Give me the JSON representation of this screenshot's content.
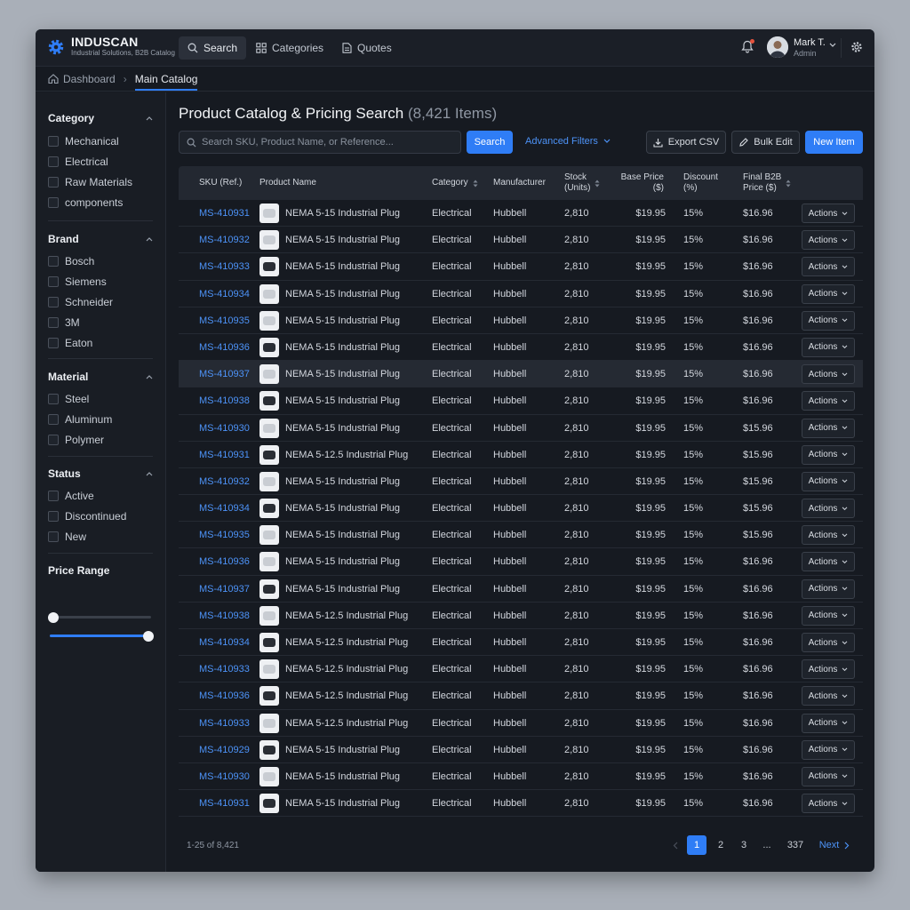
{
  "app": {
    "name": "INDUSCAN",
    "tagline": "Industrial Solutions, B2B Catalog"
  },
  "nav": {
    "search": "Search",
    "categories": "Categories",
    "quotes": "Quotes"
  },
  "user": {
    "name": "Mark T.",
    "role": "Admin"
  },
  "breadcrumb": {
    "home": "Dashboard",
    "current": "Main Catalog"
  },
  "filters": {
    "category": {
      "title": "Category",
      "items": [
        "Mechanical",
        "Electrical",
        "Raw Materials",
        "components"
      ]
    },
    "brand": {
      "title": "Brand",
      "items": [
        "Bosch",
        "Siemens",
        "Schneider",
        "3M",
        "Eaton"
      ]
    },
    "material": {
      "title": "Material",
      "items": [
        "Steel",
        "Aluminum",
        "Polymer"
      ]
    },
    "status": {
      "title": "Status",
      "items": [
        "Active",
        "Discontinued",
        "New"
      ]
    },
    "price": {
      "title": "Price Range",
      "min_fraction": 0.0,
      "max_fraction": 1.0
    }
  },
  "main": {
    "title": "Product Catalog & Pricing Search",
    "count": "(8,421 Items)",
    "search_placeholder": "Search SKU, Product Name, or Reference...",
    "search_button": "Search",
    "advanced_filters": "Advanced Filters",
    "export_csv": "Export CSV",
    "bulk_edit": "Bulk Edit",
    "new_item": "New Item"
  },
  "table": {
    "headers": {
      "sku": "SKU (Ref.)",
      "product": "Product Name",
      "category": "Category",
      "manufacturer": "Manufacturer",
      "stock_1": "Stock",
      "stock_2": "(Units)",
      "base_1": "Base Price",
      "base_2": "($)",
      "disc_1": "Discount",
      "disc_2": "(%)",
      "final_1": "Final B2B",
      "final_2": "Price ($)"
    },
    "rows": [
      {
        "sku": "MS-410931",
        "name": "NEMA 5-15 Industrial Plug",
        "category": "Electrical",
        "manufacturer": "Hubbell",
        "stock": "2,810",
        "base": "$19.95",
        "discount": "15%",
        "final": "$16.96",
        "action": "Actions",
        "thumb": "light"
      },
      {
        "sku": "MS-410932",
        "name": "NEMA 5-15 Industrial Plug",
        "category": "Electrical",
        "manufacturer": "Hubbell",
        "stock": "2,810",
        "base": "$19.95",
        "discount": "15%",
        "final": "$16.96",
        "action": "Actions",
        "thumb": "light"
      },
      {
        "sku": "MS-410933",
        "name": "NEMA 5-15 Industrial Plug",
        "category": "Electrical",
        "manufacturer": "Hubbell",
        "stock": "2,810",
        "base": "$19.95",
        "discount": "15%",
        "final": "$16.96",
        "action": "Actions",
        "thumb": "dark"
      },
      {
        "sku": "MS-410934",
        "name": "NEMA 5-15 Industrial Plug",
        "category": "Electrical",
        "manufacturer": "Hubbell",
        "stock": "2,810",
        "base": "$19.95",
        "discount": "15%",
        "final": "$16.96",
        "action": "Actions",
        "thumb": "light"
      },
      {
        "sku": "MS-410935",
        "name": "NEMA 5-15 Industrial Plug",
        "category": "Electrical",
        "manufacturer": "Hubbell",
        "stock": "2,810",
        "base": "$19.95",
        "discount": "15%",
        "final": "$16.96",
        "action": "Actions",
        "thumb": "light"
      },
      {
        "sku": "MS-410936",
        "name": "NEMA 5-15 Industrial Plug",
        "category": "Electrical",
        "manufacturer": "Hubbell",
        "stock": "2,810",
        "base": "$19.95",
        "discount": "15%",
        "final": "$16.96",
        "action": "Actions",
        "thumb": "dark"
      },
      {
        "sku": "MS-410937",
        "name": "NEMA 5-15 Industrial Plug",
        "category": "Electrical",
        "manufacturer": "Hubbell",
        "stock": "2,810",
        "base": "$19.95",
        "discount": "15%",
        "final": "$16.96",
        "action": "Actions",
        "thumb": "light",
        "highlight": true
      },
      {
        "sku": "MS-410938",
        "name": "NEMA 5-15 Industrial Plug",
        "category": "Electrical",
        "manufacturer": "Hubbell",
        "stock": "2,810",
        "base": "$19.95",
        "discount": "15%",
        "final": "$16.96",
        "action": "Actions",
        "thumb": "dark"
      },
      {
        "sku": "MS-410930",
        "name": "NEMA 5-15 Industrial Plug",
        "category": "Electrical",
        "manufacturer": "Hubbell",
        "stock": "2,810",
        "base": "$19.95",
        "discount": "15%",
        "final": "$15.96",
        "action": "Actions",
        "thumb": "light"
      },
      {
        "sku": "MS-410931",
        "name": "NEMA 5-12.5 Industrial Plug",
        "category": "Electrical",
        "manufacturer": "Hubbell",
        "stock": "2,810",
        "base": "$19.95",
        "discount": "15%",
        "final": "$15.96",
        "action": "Actions",
        "thumb": "dark"
      },
      {
        "sku": "MS-410932",
        "name": "NEMA 5-15 Industrial Plug",
        "category": "Electrical",
        "manufacturer": "Hubbell",
        "stock": "2,810",
        "base": "$19.95",
        "discount": "15%",
        "final": "$15.96",
        "action": "Actions",
        "thumb": "light"
      },
      {
        "sku": "MS-410934",
        "name": "NEMA 5-15 Industrial Plug",
        "category": "Electrical",
        "manufacturer": "Hubbell",
        "stock": "2,810",
        "base": "$19.95",
        "discount": "15%",
        "final": "$15.96",
        "action": "Actions",
        "thumb": "dark"
      },
      {
        "sku": "MS-410935",
        "name": "NEMA 5-15 Industrial Plug",
        "category": "Electrical",
        "manufacturer": "Hubbell",
        "stock": "2,810",
        "base": "$19.95",
        "discount": "15%",
        "final": "$15.96",
        "action": "Actions",
        "thumb": "light"
      },
      {
        "sku": "MS-410936",
        "name": "NEMA 5-15 Industrial Plug",
        "category": "Electrical",
        "manufacturer": "Hubbell",
        "stock": "2,810",
        "base": "$19.95",
        "discount": "15%",
        "final": "$16.96",
        "action": "Actions",
        "thumb": "light"
      },
      {
        "sku": "MS-410937",
        "name": "NEMA 5-15 Industrial Plug",
        "category": "Electrical",
        "manufacturer": "Hubbell",
        "stock": "2,810",
        "base": "$19.95",
        "discount": "15%",
        "final": "$16.96",
        "action": "Actions",
        "thumb": "dark"
      },
      {
        "sku": "MS-410938",
        "name": "NEMA 5-12.5 Industrial Plug",
        "category": "Electrical",
        "manufacturer": "Hubbell",
        "stock": "2,810",
        "base": "$19.95",
        "discount": "15%",
        "final": "$16.96",
        "action": "Actions",
        "thumb": "light"
      },
      {
        "sku": "MS-410934",
        "name": "NEMA 5-12.5 Industrial Plug",
        "category": "Electrical",
        "manufacturer": "Hubbell",
        "stock": "2,810",
        "base": "$19.95",
        "discount": "15%",
        "final": "$16.96",
        "action": "Actions",
        "thumb": "dark"
      },
      {
        "sku": "MS-410933",
        "name": "NEMA 5-12.5 Industrial Plug",
        "category": "Electrical",
        "manufacturer": "Hubbell",
        "stock": "2,810",
        "base": "$19.95",
        "discount": "15%",
        "final": "$16.96",
        "action": "Actions",
        "thumb": "light"
      },
      {
        "sku": "MS-410936",
        "name": "NEMA 5-12.5 Industrial Plug",
        "category": "Electrical",
        "manufacturer": "Hubbell",
        "stock": "2,810",
        "base": "$19.95",
        "discount": "15%",
        "final": "$16.96",
        "action": "Actions",
        "thumb": "dark"
      },
      {
        "sku": "MS-410933",
        "name": "NEMA 5-12.5 Industrial Plug",
        "category": "Electrical",
        "manufacturer": "Hubbell",
        "stock": "2,810",
        "base": "$19.95",
        "discount": "15%",
        "final": "$16.96",
        "action": "Actions",
        "thumb": "light"
      },
      {
        "sku": "MS-410929",
        "name": "NEMA 5-15 Industrial Plug",
        "category": "Electrical",
        "manufacturer": "Hubbell",
        "stock": "2,810",
        "base": "$19.95",
        "discount": "15%",
        "final": "$16.96",
        "action": "Actions",
        "thumb": "dark"
      },
      {
        "sku": "MS-410930",
        "name": "NEMA 5-15 Industrial Plug",
        "category": "Electrical",
        "manufacturer": "Hubbell",
        "stock": "2,810",
        "base": "$19.95",
        "discount": "15%",
        "final": "$16.96",
        "action": "Actions",
        "thumb": "light"
      },
      {
        "sku": "MS-410931",
        "name": "NEMA 5-15 Industrial Plug",
        "category": "Electrical",
        "manufacturer": "Hubbell",
        "stock": "2,810",
        "base": "$19.95",
        "discount": "15%",
        "final": "$16.96",
        "action": "Actions",
        "thumb": "dark"
      }
    ]
  },
  "pagination": {
    "range": "1-25 of 8,421",
    "pages": [
      "1",
      "2",
      "3",
      "...",
      "337"
    ],
    "next": "Next"
  },
  "colors": {
    "accent": "#2f7df6",
    "background": "#161a21",
    "notification": "#e5533d"
  }
}
